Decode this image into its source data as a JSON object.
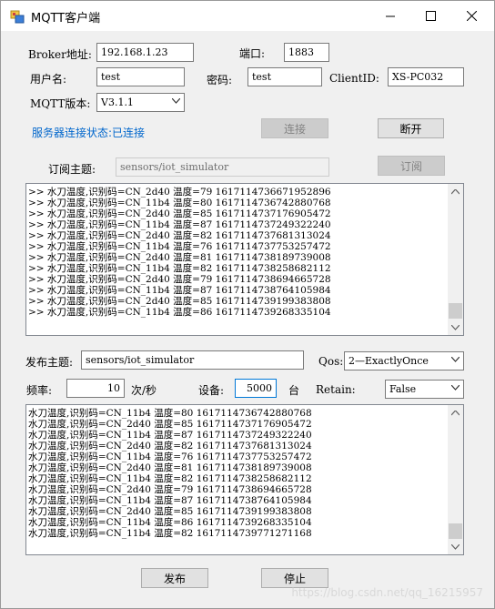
{
  "window": {
    "title": "MQTT客户端"
  },
  "connection": {
    "broker_label": "Broker地址:",
    "broker_value": "192.168.1.23",
    "port_label": "端口:",
    "port_value": "1883",
    "username_label": "用户名:",
    "username_value": "test",
    "password_label": "密码:",
    "password_value": "test",
    "clientid_label": "ClientID:",
    "clientid_value": "XS-PC032",
    "version_label": "MQTT版本:",
    "version_value": "V3.1.1",
    "status_text": "服务器连接状态:已连接",
    "connect_label": "连接",
    "disconnect_label": "断开"
  },
  "subscribe": {
    "topic_label": "订阅主题:",
    "topic_value": "sensors/iot_simulator",
    "subscribe_label": "订阅",
    "received": [
      ">> 水刀温度,识别码=CN_2d40 温度=79 1617114736671952896",
      ">> 水刀温度,识别码=CN_11b4 温度=80 1617114736742880768",
      ">> 水刀温度,识别码=CN_2d40 温度=85 1617114737176905472",
      ">> 水刀温度,识别码=CN_11b4 温度=87 1617114737249322240",
      ">> 水刀温度,识别码=CN_2d40 温度=82 1617114737681313024",
      ">> 水刀温度,识别码=CN_11b4 温度=76 1617114737753257472",
      ">> 水刀温度,识别码=CN_2d40 温度=81 1617114738189739008",
      ">> 水刀温度,识别码=CN_11b4 温度=82 1617114738258682112",
      ">> 水刀温度,识别码=CN_2d40 温度=79 1617114738694665728",
      ">> 水刀温度,识别码=CN_11b4 温度=87 1617114738764105984",
      ">> 水刀温度,识别码=CN_2d40 温度=85 1617114739199383808",
      ">> 水刀温度,识别码=CN_11b4 温度=86 1617114739268335104"
    ]
  },
  "publish": {
    "topic_label": "发布主题:",
    "topic_value": "sensors/iot_simulator",
    "qos_label": "Qos:",
    "qos_value": "2—ExactlyOnce",
    "freq_label": "频率:",
    "freq_value": "10",
    "freq_unit": "次/秒",
    "device_label": "设备:",
    "device_value": "5000",
    "device_unit": "台",
    "retain_label": "Retain:",
    "retain_value": "False",
    "sent": [
      "水刀温度,识别码=CN_11b4 温度=80 1617114736742880768",
      "水刀温度,识别码=CN_2d40 温度=85 1617114737176905472",
      "水刀温度,识别码=CN_11b4 温度=87 1617114737249322240",
      "水刀温度,识别码=CN_2d40 温度=82 1617114737681313024",
      "水刀温度,识别码=CN_11b4 温度=76 1617114737753257472",
      "水刀温度,识别码=CN_2d40 温度=81 1617114738189739008",
      "水刀温度,识别码=CN_11b4 温度=82 1617114738258682112",
      "水刀温度,识别码=CN_2d40 温度=79 1617114738694665728",
      "水刀温度,识别码=CN_11b4 温度=87 1617114738764105984",
      "水刀温度,识别码=CN_2d40 温度=85 1617114739199383808",
      "水刀温度,识别码=CN_11b4 温度=86 1617114739268335104",
      "水刀温度,识别码=CN_11b4 温度=82 1617114739771271168"
    ],
    "publish_label": "发布",
    "stop_label": "停止"
  },
  "watermark": "https://blog.csdn.net/qq_16215957"
}
